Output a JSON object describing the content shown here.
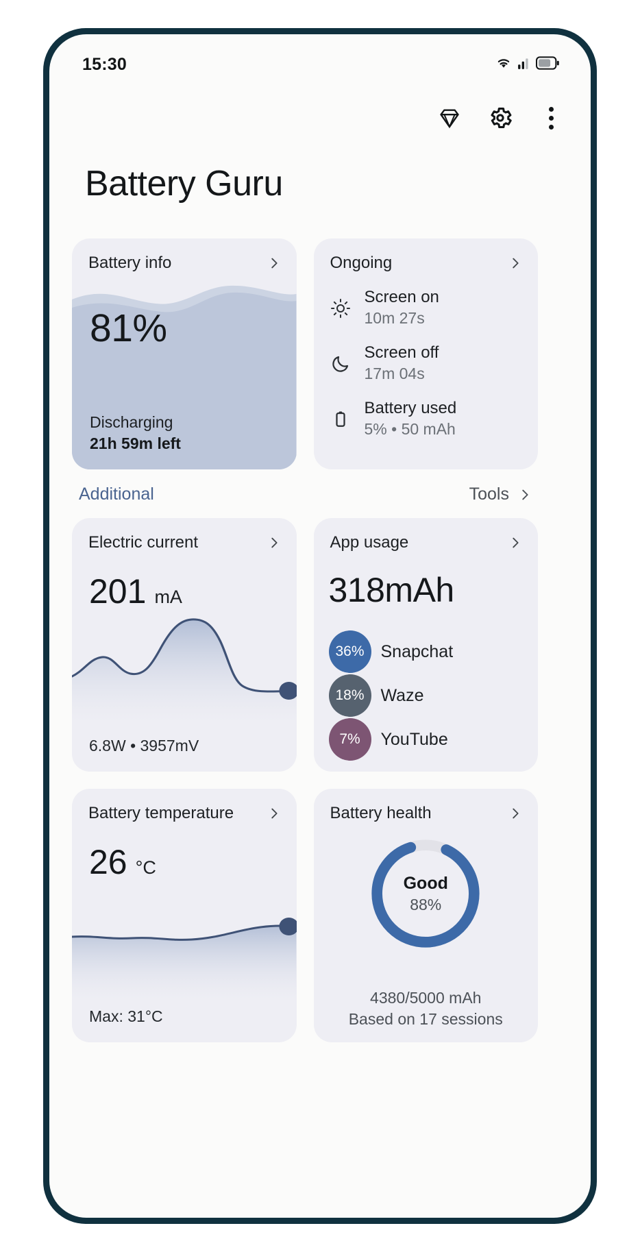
{
  "status_bar": {
    "time": "15:30",
    "icons": [
      "wifi-icon",
      "cellular-signal-icon",
      "battery-icon"
    ]
  },
  "action_bar": {
    "premium_label": "premium-diamond-icon",
    "settings_label": "gear-icon",
    "overflow_label": "more-vertical-icon"
  },
  "header": {
    "title": "Battery Guru"
  },
  "battery_info": {
    "title": "Battery info",
    "percent": "81%",
    "state": "Discharging",
    "time_left": "21h 59m left",
    "fill_color": "#bcc6da",
    "fill_color_light": "#ccd4e3"
  },
  "ongoing": {
    "title": "Ongoing",
    "items": [
      {
        "icon": "sun-icon",
        "label": "Screen on",
        "value": "10m 27s"
      },
      {
        "icon": "moon-icon",
        "label": "Screen off",
        "value": "17m 04s"
      },
      {
        "icon": "battery-vertical-icon",
        "label": "Battery used",
        "value": "5% • 50 mAh"
      }
    ]
  },
  "section": {
    "left_label": "Additional",
    "left_color": "#4a6490",
    "right_label": "Tools"
  },
  "electric_current": {
    "title": "Electric current",
    "value": "201",
    "unit": "mA",
    "footer": "6.8W • 3957mV",
    "line_color": "#3f5276"
  },
  "app_usage": {
    "title": "App usage",
    "total": "318mAh",
    "apps": [
      {
        "percent": "36%",
        "name": "Snapchat",
        "color": "#3d6aa8"
      },
      {
        "percent": "18%",
        "name": "Waze",
        "color": "#56626f"
      },
      {
        "percent": "7%",
        "name": "YouTube",
        "color": "#7d5573"
      }
    ]
  },
  "battery_temperature": {
    "title": "Battery temperature",
    "value": "26",
    "unit": "°C",
    "footer": "Max: 31°C",
    "line_color": "#3f5276"
  },
  "battery_health": {
    "title": "Battery health",
    "status": "Good",
    "percent": "88%",
    "capacity": "4380/5000 mAh",
    "sessions": "Based on 17 sessions",
    "ring_color": "#3d6aa8",
    "track_color": "#e2e2e8"
  },
  "chart_data": [
    {
      "type": "line",
      "title": "Electric current",
      "ylabel": "mA",
      "x": [
        0,
        1,
        2,
        3,
        4,
        5,
        6,
        7,
        8,
        9,
        10,
        11,
        12
      ],
      "values": [
        148,
        170,
        182,
        160,
        142,
        158,
        212,
        244,
        252,
        250,
        224,
        170,
        152
      ],
      "current_value": 201,
      "grid": false,
      "legend": "none"
    },
    {
      "type": "line",
      "title": "Battery temperature",
      "ylabel": "°C",
      "x": [
        0,
        1,
        2,
        3,
        4,
        5,
        6,
        7,
        8,
        9,
        10,
        11,
        12
      ],
      "values": [
        26,
        26,
        26,
        25.8,
        26,
        26,
        26,
        25.9,
        26,
        26,
        26.2,
        26.4,
        26.3
      ],
      "current_value": 26,
      "max_value": 31,
      "grid": false,
      "legend": "none"
    },
    {
      "type": "pie",
      "title": "App usage",
      "categories": [
        "Snapchat",
        "Waze",
        "YouTube"
      ],
      "values": [
        36,
        18,
        7
      ],
      "unit": "%",
      "total": "318mAh",
      "legend": "right"
    },
    {
      "type": "pie",
      "title": "Battery health",
      "categories": [
        "Health",
        "Remaining"
      ],
      "values": [
        88,
        12
      ],
      "unit": "%",
      "annotation": "Good",
      "legend": "none"
    }
  ]
}
